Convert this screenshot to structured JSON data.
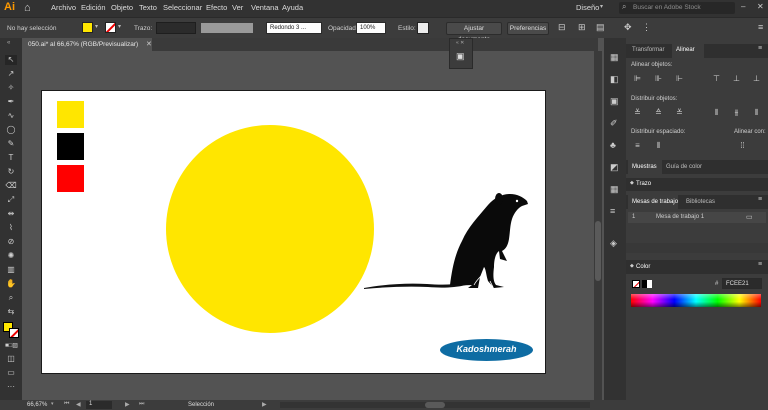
{
  "app": {
    "logo": "Ai"
  },
  "menu": {
    "items": [
      "Archivo",
      "Edición",
      "Objeto",
      "Texto",
      "Seleccionar",
      "Efecto",
      "Ver",
      "Ventana",
      "Ayuda"
    ],
    "workspace": "Diseño",
    "search_placeholder": "Buscar en Adobe Stock"
  },
  "control": {
    "selection_label": "No hay selección",
    "stroke_label": "Trazo:",
    "brush_value": "Redondo 3 ...",
    "opacity_label": "Opacidad:",
    "opacity_value": "100%",
    "style_label": "Estilo:",
    "adjust_button": "Ajustar documento",
    "prefs_button": "Preferencias",
    "fill_color": "#ffe600"
  },
  "document": {
    "tab_title": "050.ai* al 66,67% (RGB/Previsualizar)",
    "zoom": "66,67%",
    "artboard_number": "1",
    "status": "Selección"
  },
  "artwork": {
    "swatch_colors": [
      "#ffe600",
      "#000000",
      "#ff0000"
    ],
    "circle_color": "#ffe600",
    "watermark": "Kadoshmerah",
    "watermark_color": "#0e6ca3"
  },
  "panels": {
    "top_tabs": [
      "Transformar",
      "Alinear"
    ],
    "align_objects": "Alinear objetos:",
    "distribute_objects": "Distribuir objetos:",
    "distribute_spacing": "Distribuir espaciado:",
    "align_to": "Alinear con:",
    "swatch_tabs": [
      "Muestras",
      "Guía de color"
    ],
    "stroke_tab": "Trazo",
    "artboard_tabs": [
      "Mesas de trabajo",
      "Bibliotecas"
    ],
    "artboard_row": {
      "number": "1",
      "name": "Mesa de trabajo 1"
    },
    "color_tab": "Color",
    "color_hash": "#",
    "color_hex": "FCEE21"
  }
}
